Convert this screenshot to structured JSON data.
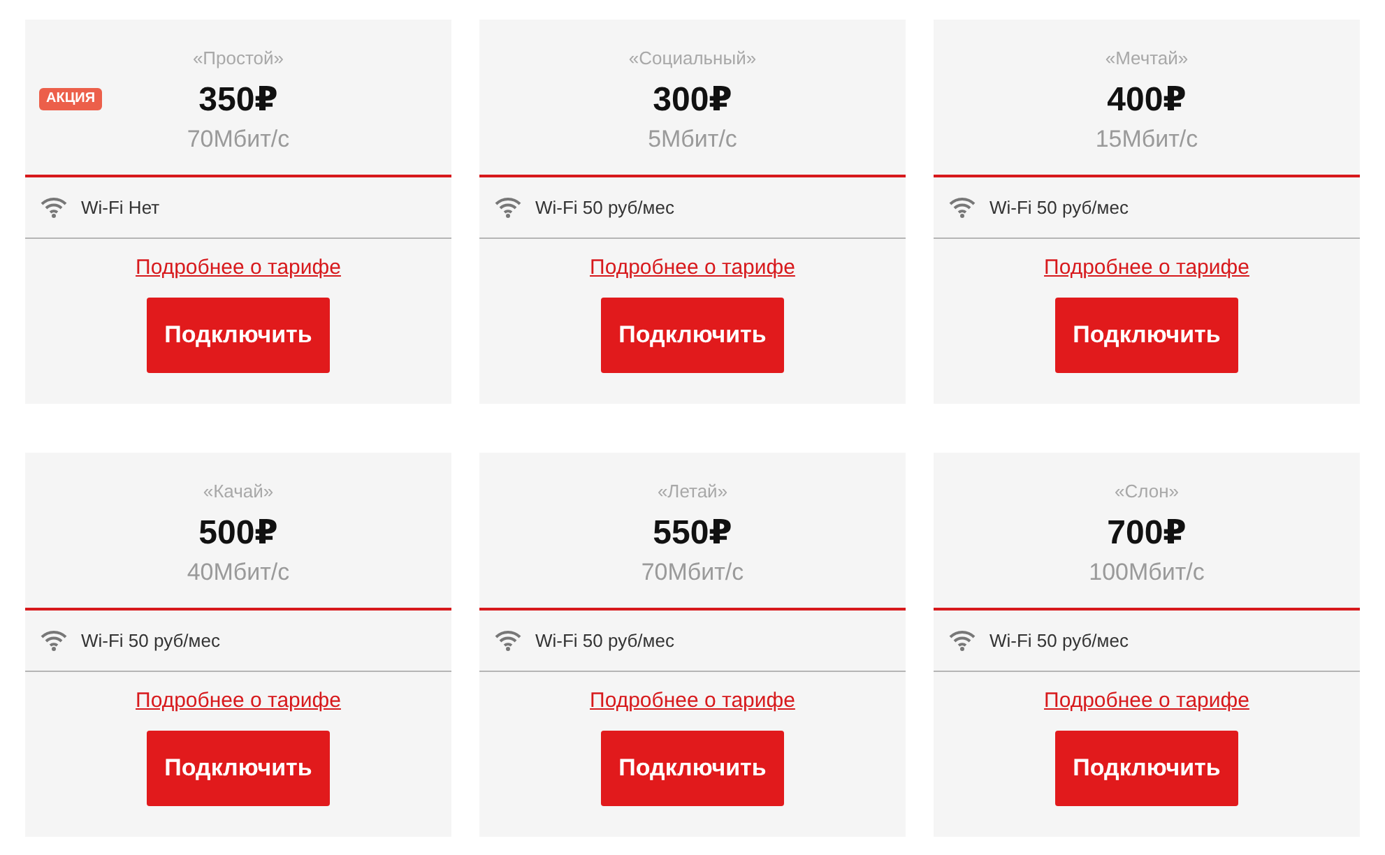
{
  "tariffs": [
    {
      "name": "«Простой»",
      "badge": "АКЦИЯ",
      "price": "350₽",
      "speed": "70Мбит/с",
      "wifi": "Wi-Fi Нет",
      "link": "Подробнее о тарифе",
      "button": "Подключить"
    },
    {
      "name": "«Социальный»",
      "price": "300₽",
      "speed": "5Мбит/с",
      "wifi": "Wi-Fi 50 руб/мес",
      "link": "Подробнее о тарифе",
      "button": "Подключить"
    },
    {
      "name": "«Мечтай»",
      "price": "400₽",
      "speed": "15Мбит/с",
      "wifi": "Wi-Fi 50 руб/мес",
      "link": "Подробнее о тарифе",
      "button": "Подключить"
    },
    {
      "name": "«Качай»",
      "price": "500₽",
      "speed": "40Мбит/с",
      "wifi": "Wi-Fi 50 руб/мес",
      "link": "Подробнее о тарифе",
      "button": "Подключить"
    },
    {
      "name": "«Летай»",
      "price": "550₽",
      "speed": "70Мбит/с",
      "wifi": "Wi-Fi 50 руб/мес",
      "link": "Подробнее о тарифе",
      "button": "Подключить"
    },
    {
      "name": "«Слон»",
      "price": "700₽",
      "speed": "100Мбит/с",
      "wifi": "Wi-Fi 50 руб/мес",
      "link": "Подробнее о тарифе",
      "button": "Подключить"
    }
  ]
}
